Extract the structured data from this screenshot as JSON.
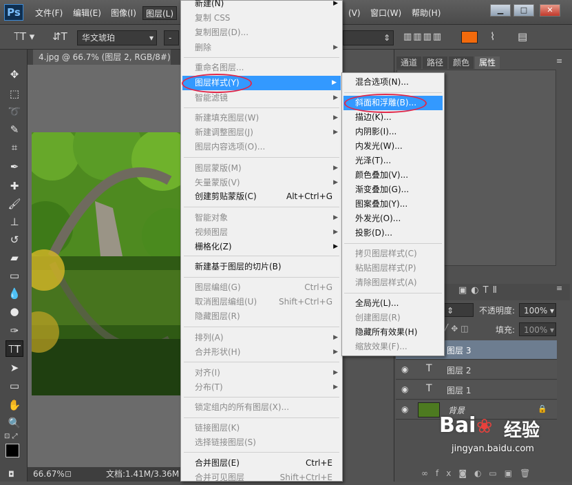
{
  "app": {
    "logo": "Ps"
  },
  "menubar": {
    "items": [
      "文件(F)",
      "编辑(E)",
      "图像(I)",
      "图层(L)",
      "(V)",
      "窗口(W)",
      "帮助(H)"
    ]
  },
  "window_controls": {
    "minimize": "▁",
    "maximize": "□",
    "close": "✕"
  },
  "options_bar": {
    "font_name": "华文琥珀",
    "font_size": "-",
    "color_hex": "#f26a0c"
  },
  "doc_tab": {
    "title": "4.jpg @ 66.7% (图层 2, RGB/8#) *",
    "close": "×"
  },
  "status": {
    "zoom": "66.67%",
    "doc_info": "文档:1.41M/3.36M"
  },
  "panel_tabs": [
    "通道",
    "路径",
    "颜色",
    "属性"
  ],
  "layers_panel": {
    "opacity_label": "不透明度:",
    "opacity_value": "100%",
    "fill_label": "填充:",
    "fill_value": "100%",
    "layers": [
      {
        "name": "图层 3",
        "type": "text",
        "selected": true
      },
      {
        "name": "图层 2",
        "type": "text",
        "selected": false
      },
      {
        "name": "图层 1",
        "type": "text",
        "selected": false
      },
      {
        "name": "背景",
        "type": "image",
        "selected": false
      }
    ]
  },
  "layer_menu": {
    "items": [
      {
        "label": "新建(N)",
        "disabled": false,
        "arrow": true
      },
      {
        "label": "复制 CSS",
        "disabled": true
      },
      {
        "label": "复制图层(D)...",
        "disabled": true
      },
      {
        "label": "删除",
        "disabled": true,
        "arrow": true
      },
      {
        "label": "重命名图层...",
        "disabled": true
      },
      {
        "label": "图层样式(Y)",
        "disabled": false,
        "arrow": true,
        "highlighted": true
      },
      {
        "label": "智能滤镜",
        "disabled": true,
        "arrow": true
      },
      {
        "label": "新建填充图层(W)",
        "disabled": true,
        "arrow": true
      },
      {
        "label": "新建调整图层(J)",
        "disabled": true,
        "arrow": true
      },
      {
        "label": "图层内容选项(O)...",
        "disabled": true
      },
      {
        "label": "图层蒙版(M)",
        "disabled": true,
        "arrow": true
      },
      {
        "label": "矢量蒙版(V)",
        "disabled": true,
        "arrow": true
      },
      {
        "label": "创建剪贴蒙版(C)",
        "disabled": false,
        "shortcut": "Alt+Ctrl+G"
      },
      {
        "label": "智能对象",
        "disabled": true,
        "arrow": true
      },
      {
        "label": "视频图层",
        "disabled": true,
        "arrow": true
      },
      {
        "label": "栅格化(Z)",
        "disabled": false,
        "arrow": true
      },
      {
        "label": "新建基于图层的切片(B)",
        "disabled": false
      },
      {
        "label": "图层编组(G)",
        "disabled": true,
        "shortcut": "Ctrl+G"
      },
      {
        "label": "取消图层编组(U)",
        "disabled": true,
        "shortcut": "Shift+Ctrl+G"
      },
      {
        "label": "隐藏图层(R)",
        "disabled": true
      },
      {
        "label": "排列(A)",
        "disabled": true,
        "arrow": true
      },
      {
        "label": "合并形状(H)",
        "disabled": true,
        "arrow": true
      },
      {
        "label": "对齐(I)",
        "disabled": true,
        "arrow": true
      },
      {
        "label": "分布(T)",
        "disabled": true,
        "arrow": true
      },
      {
        "label": "锁定组内的所有图层(X)...",
        "disabled": true
      },
      {
        "label": "链接图层(K)",
        "disabled": true
      },
      {
        "label": "选择链接图层(S)",
        "disabled": true
      },
      {
        "label": "合并图层(E)",
        "disabled": false,
        "shortcut": "Ctrl+E"
      },
      {
        "label": "合并可见图层",
        "disabled": true,
        "shortcut": "Shift+Ctrl+E"
      }
    ]
  },
  "style_submenu": {
    "items": [
      {
        "label": "混合选项(N)...",
        "disabled": false
      },
      {
        "label": "斜面和浮雕(B)...",
        "disabled": false,
        "highlighted": true
      },
      {
        "label": "描边(K)...",
        "disabled": false
      },
      {
        "label": "内阴影(I)...",
        "disabled": false
      },
      {
        "label": "内发光(W)...",
        "disabled": false
      },
      {
        "label": "光泽(T)...",
        "disabled": false
      },
      {
        "label": "颜色叠加(V)...",
        "disabled": false
      },
      {
        "label": "渐变叠加(G)...",
        "disabled": false
      },
      {
        "label": "图案叠加(Y)...",
        "disabled": false
      },
      {
        "label": "外发光(O)...",
        "disabled": false
      },
      {
        "label": "投影(D)...",
        "disabled": false
      },
      {
        "label": "拷贝图层样式(C)",
        "disabled": true
      },
      {
        "label": "粘贴图层样式(P)",
        "disabled": true
      },
      {
        "label": "清除图层样式(A)",
        "disabled": true
      },
      {
        "label": "全局光(L)...",
        "disabled": false
      },
      {
        "label": "创建图层(R)",
        "disabled": true
      },
      {
        "label": "隐藏所有效果(H)",
        "disabled": false
      },
      {
        "label": "缩放效果(F)...",
        "disabled": true
      }
    ]
  },
  "watermark": {
    "brand": "Bai",
    "brand2": "经验",
    "url": "jingyan.baidu.com"
  }
}
